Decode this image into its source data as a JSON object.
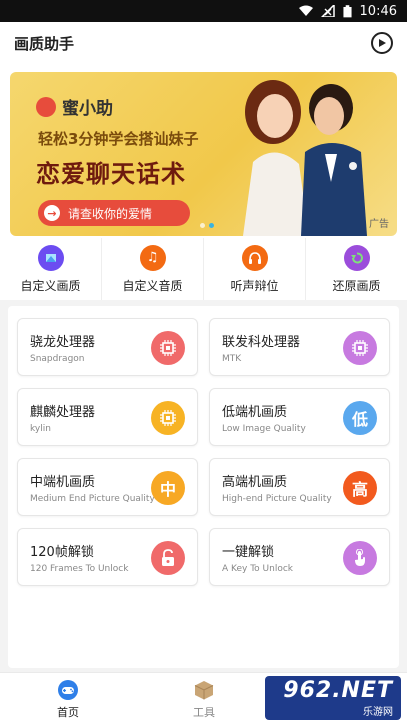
{
  "status_bar": {
    "time": "10:46"
  },
  "header": {
    "title": "画质助手"
  },
  "banner": {
    "brand": "蜜小助",
    "line1": "轻松3分钟学会搭讪妹子",
    "line2": "恋爱聊天话术",
    "cta": "请查收你的爱情",
    "ad_tag": "广告"
  },
  "quick_actions": [
    {
      "label": "自定义画质",
      "icon": "video-icon",
      "color": "#6c4cf1"
    },
    {
      "label": "自定义音质",
      "icon": "music-icon",
      "color": "#f36a12"
    },
    {
      "label": "听声辩位",
      "icon": "headphones-icon",
      "color": "#f36a12"
    },
    {
      "label": "还原画质",
      "icon": "restore-icon",
      "color": "#9b4ddb"
    }
  ],
  "cards": [
    {
      "title": "骁龙处理器",
      "subtitle": "Snapdragon",
      "icon": "chip-icon",
      "color": "#f06a6a"
    },
    {
      "title": "联发科处理器",
      "subtitle": "MTK",
      "icon": "chip-icon",
      "color": "#c77ae0"
    },
    {
      "title": "麒麟处理器",
      "subtitle": "kylin",
      "icon": "chip-icon",
      "color": "#f7b324"
    },
    {
      "title": "低端机画质",
      "subtitle": "Low Image Quality",
      "icon_text": "低",
      "color": "#5aa8ee"
    },
    {
      "title": "中端机画质",
      "subtitle": "Medium End Picture Quality",
      "icon_text": "中",
      "color": "#f7a824"
    },
    {
      "title": "高端机画质",
      "subtitle": "High-end Picture Quality",
      "icon_text": "高",
      "color": "#f25a1e"
    },
    {
      "title": "120帧解锁",
      "subtitle": "120 Frames To Unlock",
      "icon": "unlock-icon",
      "color": "#f06a6a"
    },
    {
      "title": "一键解锁",
      "subtitle": "A Key To Unlock",
      "icon": "touch-icon",
      "color": "#c77ae0"
    }
  ],
  "bottom_nav": [
    {
      "label": "首页",
      "icon": "gamepad-icon",
      "active": true
    },
    {
      "label": "工具",
      "icon": "box-icon",
      "active": false
    }
  ],
  "watermark": {
    "big": "962.NET",
    "small": "乐游网"
  }
}
